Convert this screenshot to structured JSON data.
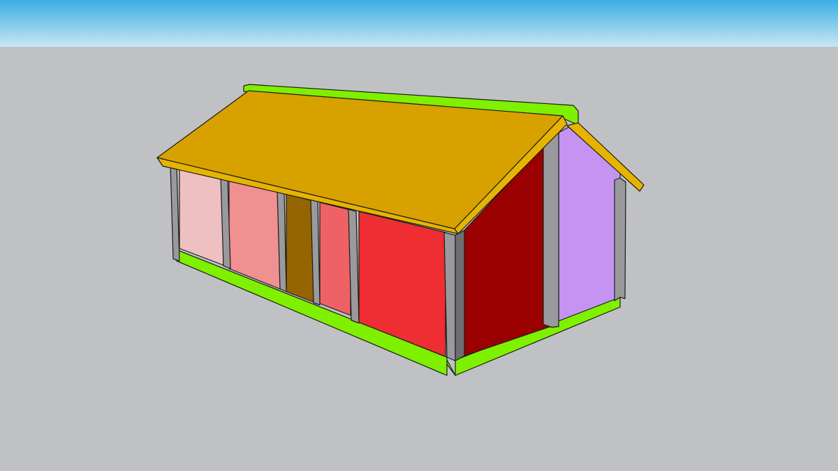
{
  "scene": {
    "colors": {
      "sky_top": "#3aaee2",
      "sky_bottom": "#c9e6f4",
      "ground": "#c0c1c4",
      "edge": "#1a1a1a",
      "roof_top": "#d7a100",
      "roof_fascia": "#e6b400",
      "roof_ridge": "#7ff000",
      "base_sill": "#7ff000",
      "post": "#9a9a9c",
      "post_dark": "#6e6e70",
      "panel_1": "#efc0c2",
      "panel_2": "#f09090",
      "door": "#946400",
      "panel_3": "#ee6266",
      "panel_4": "#ee2e33",
      "end_wall_red": "#9a0000",
      "end_wall_purple": "#c593f2"
    }
  }
}
